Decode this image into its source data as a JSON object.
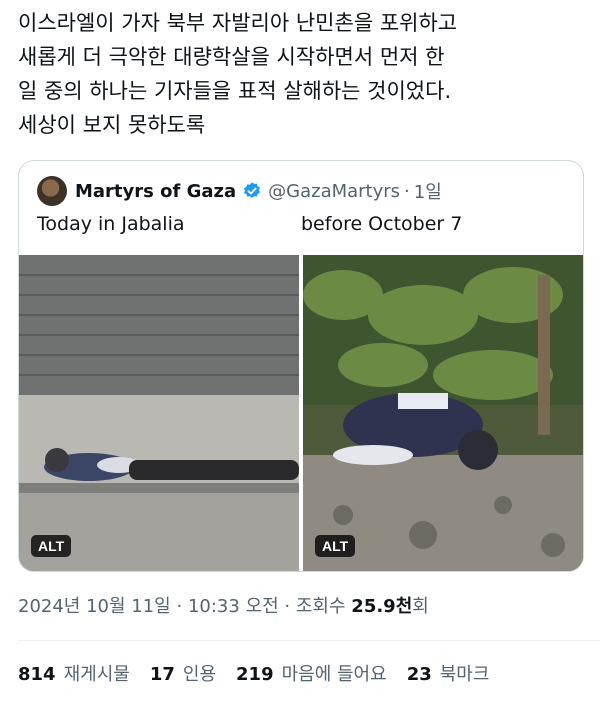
{
  "tweet": {
    "lines": [
      "이스라엘이 가자 북부 자발리아 난민촌을 포위하고",
      "새롭게 더 극악한 대량학살을 시작하면서 먼저 한",
      "일 중의 하나는 기자들을 표적 살해하는 것이었다.",
      "세상이 보지 못하도록"
    ]
  },
  "quote": {
    "name": "Martyrs of Gaza",
    "handle": "@GazaMartyrs",
    "dot": "·",
    "time": "1일",
    "left_caption": "Today in Jabalia",
    "right_caption": "before October 7",
    "photos": [
      {
        "alt_label": "ALT",
        "icon": "photo-street"
      },
      {
        "alt_label": "ALT",
        "icon": "photo-grass"
      }
    ],
    "verified_color": "#1d9bf0"
  },
  "meta": {
    "date": "2024년 10월 11일",
    "sep1": "·",
    "time": "10:33 오전",
    "sep2": "·",
    "views_label": "조회수",
    "views_value": "25.9천",
    "views_suffix": "회"
  },
  "stats": [
    {
      "count": "814",
      "label": "재게시물"
    },
    {
      "count": "17",
      "label": "인용"
    },
    {
      "count": "219",
      "label": "마음에 들어요"
    },
    {
      "count": "23",
      "label": "북마크"
    }
  ],
  "colors": {
    "text": "#0f1419",
    "muted": "#536471",
    "border": "#cfd9de"
  }
}
